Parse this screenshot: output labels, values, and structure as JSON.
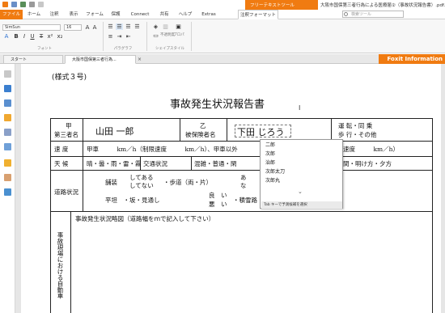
{
  "titlebar": {
    "context_tab": "フリーテキストツール",
    "document_title": "大阪市国保第三者行為による医療届②（事故状況報告書）.pdf..."
  },
  "menu": {
    "tabs": [
      "ファイル",
      "ホーム",
      "注釈",
      "表示",
      "フォーム",
      "保護",
      "Connect",
      "共有",
      "ヘルプ",
      "Extras",
      "注釈フォーマット"
    ],
    "search_placeholder": "検索ツール"
  },
  "ribbon": {
    "font_name": "SimSun",
    "font_size": "16",
    "group_font": "フォント",
    "group_paragraph": "パラグラフ",
    "group_shape_style": "シェイプスタイル",
    "opacity_label": "不透明度",
    "props_label": "プロパ"
  },
  "doc_tabs": [
    "スタート",
    "大阪市国保第三者行為..."
  ],
  "brand": "Foxit Information",
  "form": {
    "style_number": "(様式３号)",
    "title": "事故発生状況報告書",
    "party_a_label1": "甲",
    "party_a_label2": "第三者名",
    "party_a_value": "山田 一郎",
    "party_b_label1": "乙",
    "party_b_label2": "被保険者名",
    "party_b_value": "下田 じろう",
    "driving_1": "運 転・同 乗",
    "driving_2": "歩 行・その他",
    "speed_label": "速 度",
    "speed_text": "甲車　　　km／h（制限速度　　　km／h）、甲車以外",
    "speed_right": "速度　　　km／h）",
    "weather_label": "天 候",
    "weather_text": "晴・曇・雨・雷・霧",
    "traffic_label": "交通状況",
    "traffic_text": "混雑・普通・閑",
    "time_text": "間・明け方・夕方",
    "road_label": "道路状況",
    "road_paved_1": "舗装",
    "road_paved_2": "してある",
    "road_paved_3": "してない",
    "road_sidewalk": "・歩道（両・片）",
    "road_ari": "あ",
    "road_nashi": "な",
    "road_flat": "平坦　・坂・見通し",
    "road_good_1": "良　い",
    "road_good_2": "悪　い",
    "road_snow": "・積雪路",
    "diagram_title": "事故発生状況略図（道路幅をｍで記入して下さい）",
    "vertical_text": "事故現場における自動車"
  },
  "autocomplete": {
    "items": [
      "二郎",
      "次郎",
      "治郎",
      "次郎太刀",
      "次郎丸"
    ],
    "footer": "Tab キーで予測候補を選択"
  }
}
